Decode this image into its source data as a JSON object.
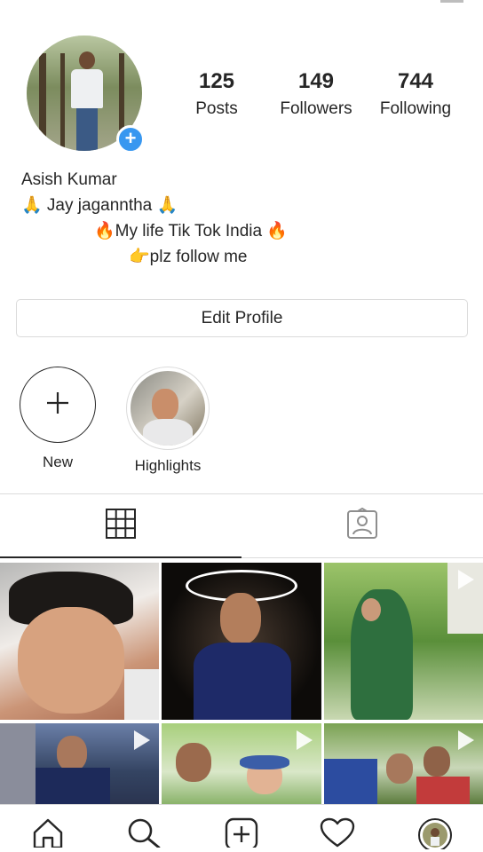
{
  "profile": {
    "name": "Asish Kumar",
    "bio": [
      "🙏 Jay jaganntha 🙏",
      "🔥My life Tik Tok India 🔥",
      "👉plz follow me"
    ]
  },
  "stats": [
    {
      "value": "125",
      "label": "Posts"
    },
    {
      "value": "149",
      "label": "Followers"
    },
    {
      "value": "744",
      "label": "Following"
    }
  ],
  "edit_profile_label": "Edit Profile",
  "highlights": [
    {
      "label": "New"
    },
    {
      "label": "Highlights"
    }
  ],
  "tabs": [
    "grid-tab",
    "tagged-tab"
  ],
  "nav": [
    "home-icon",
    "search-icon",
    "add-post-icon",
    "activity-icon",
    "profile-avatar-icon"
  ],
  "colors": {
    "accent": "#3897f0",
    "text": "#262626",
    "border": "#dbdbdb"
  }
}
